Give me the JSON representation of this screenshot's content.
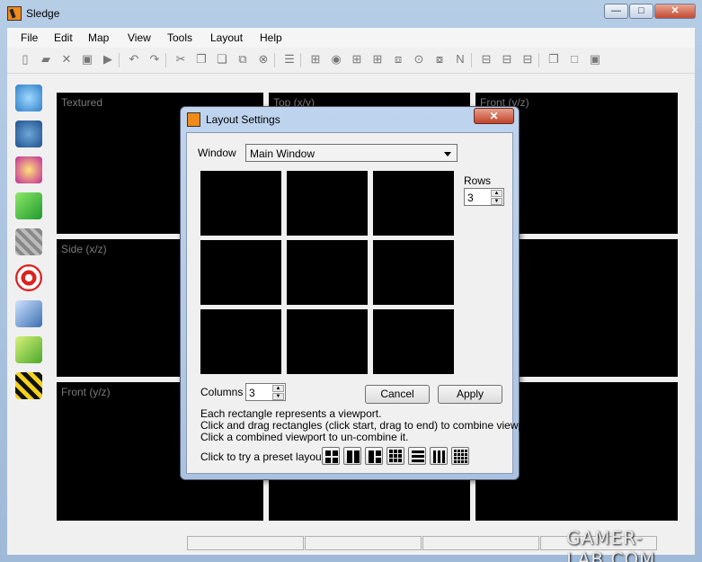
{
  "app": {
    "title": "Sledge"
  },
  "caption_buttons": {
    "minimize": "—",
    "maximize": "□",
    "close": "✕"
  },
  "menu": [
    "File",
    "Edit",
    "Map",
    "View",
    "Tools",
    "Layout",
    "Help"
  ],
  "toolbar_icons": [
    "new-icon",
    "open-icon",
    "close-file-icon",
    "save-icon",
    "compile-icon",
    "undo-icon",
    "redo-icon",
    "cut-icon",
    "copy-icon",
    "paste-icon",
    "paste-special-icon",
    "delete-icon",
    "properties-icon",
    "grid-icon",
    "show-hide-icon",
    "grid-small-icon",
    "grid-large-icon",
    "snap-icon",
    "lock-icon",
    "transform-icon",
    "n-icon",
    "layout-a-icon",
    "layout-b-icon",
    "layout-c-icon",
    "window-icon",
    "maximize-icon",
    "restore-icon"
  ],
  "tools": [
    "select-tool-icon",
    "camera-tool-icon",
    "entity-tool-icon",
    "brush-tool-icon",
    "texture-tool-icon",
    "decal-tool-icon",
    "clip-tool-icon",
    "vm-tool-icon",
    "cordon-tool-icon"
  ],
  "viewports": {
    "textured": "Textured",
    "top": "Top (x/y)",
    "front_right": "Front (y/z)",
    "side": "Side (x/z)",
    "front": "Front (y/z)"
  },
  "dialog": {
    "title": "Layout Settings",
    "close": "✕",
    "window_label": "Window",
    "window_value": "Main Window",
    "rows_label": "Rows",
    "rows_value": "3",
    "columns_label": "Columns",
    "columns_value": "3",
    "cancel": "Cancel",
    "apply": "Apply",
    "help": [
      "Each rectangle represents a viewport.",
      "Click and drag rectangles (click start, drag to end) to combine viewports.",
      "Click a combined viewport to un-combine it."
    ],
    "preset_label": "Click to try a preset layout:"
  },
  "watermark": "GAMER-LAB.COM"
}
